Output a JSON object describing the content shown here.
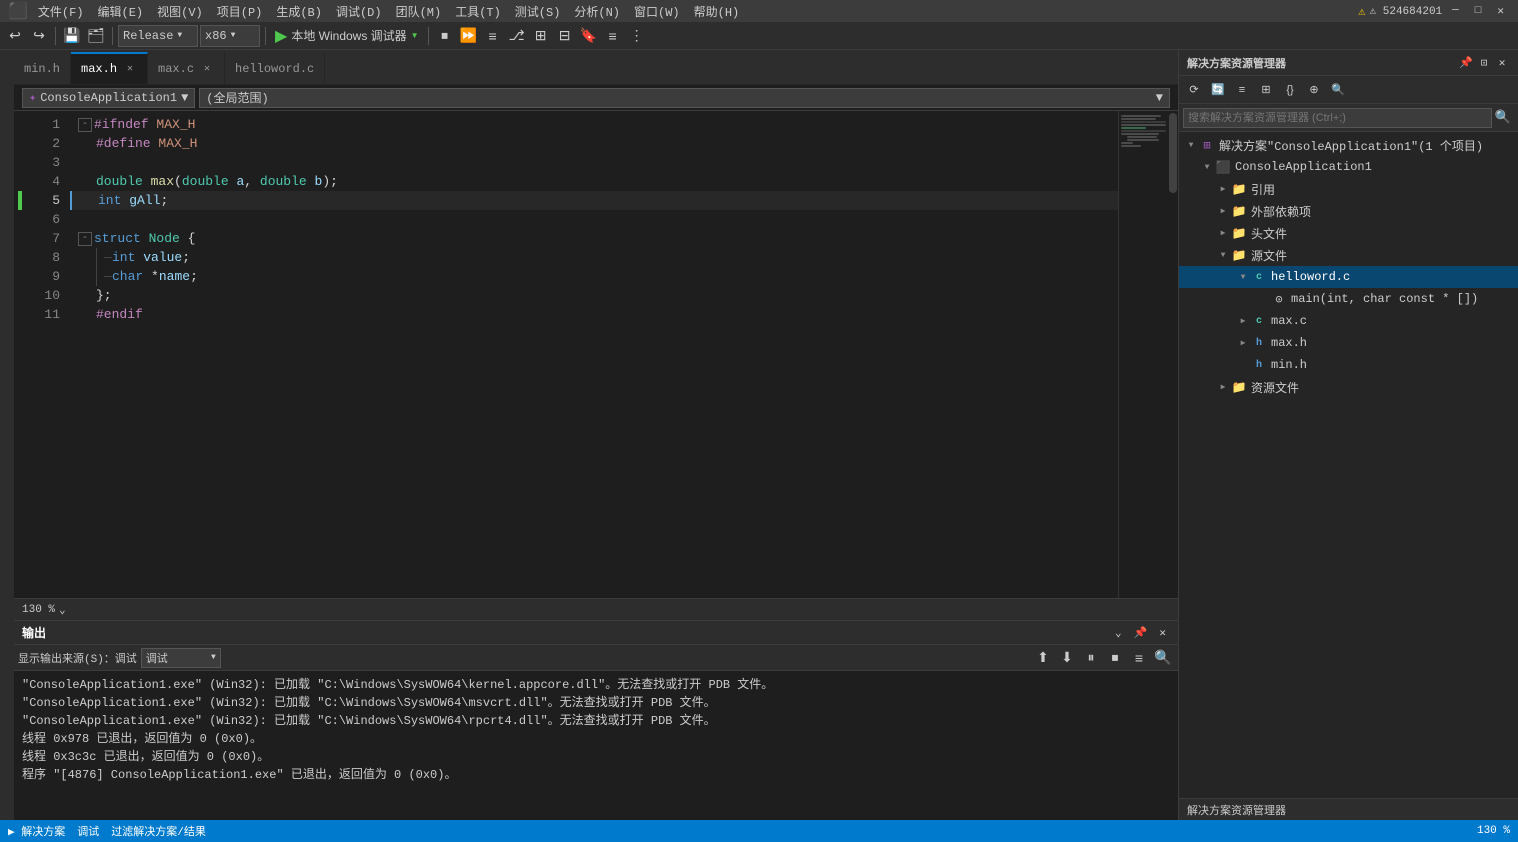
{
  "titlebar": {
    "left_icons": "≡",
    "right_text": "⚠ 524684201",
    "close_btn": "✕"
  },
  "menubar": {
    "items": [
      "文件(F)",
      "编辑(E)",
      "视图(V)",
      "项目(P)",
      "生成(B)",
      "调试(D)",
      "团队(M)",
      "工具(T)",
      "测试(S)",
      "分析(N)",
      "窗口(W)",
      "帮助(H)"
    ]
  },
  "toolbar": {
    "config_label": "Release",
    "arch_label": "x86",
    "play_label": "本地 Windows 调试器",
    "play_arrow": "▶"
  },
  "tabs": [
    {
      "label": "min.h",
      "active": false,
      "closable": false
    },
    {
      "label": "max.h",
      "active": true,
      "closable": true
    },
    {
      "label": "max.c",
      "active": false,
      "closable": true
    },
    {
      "label": "helloword.c",
      "active": false,
      "closable": false
    }
  ],
  "navbar": {
    "project": "ConsoleApplication1",
    "scope": "(全局范围)"
  },
  "code": {
    "filename": "max.h",
    "lines": [
      {
        "num": 1,
        "content": "#ifndef MAX_H",
        "type": "preprocessor"
      },
      {
        "num": 2,
        "content": "#define MAX_H",
        "type": "preprocessor"
      },
      {
        "num": 3,
        "content": "",
        "type": "empty"
      },
      {
        "num": 4,
        "content": "double max(double a, double b);",
        "type": "code"
      },
      {
        "num": 5,
        "content": "int gAll;",
        "type": "code",
        "highlighted": true
      },
      {
        "num": 6,
        "content": "",
        "type": "empty"
      },
      {
        "num": 7,
        "content": "struct Node {",
        "type": "code"
      },
      {
        "num": 8,
        "content": "    int value;",
        "type": "code"
      },
      {
        "num": 9,
        "content": "    char *name;",
        "type": "code"
      },
      {
        "num": 10,
        "content": "};",
        "type": "code"
      },
      {
        "num": 11,
        "content": "#endif",
        "type": "preprocessor"
      }
    ]
  },
  "solution_explorer": {
    "title": "解决方案资源管理器",
    "search_placeholder": "搜索解决方案资源管理器 (Ctrl+;)",
    "solution_label": "解决方案\"ConsoleApplication1\"(1 个项目)",
    "project_label": "ConsoleApplication1",
    "nodes": [
      {
        "label": "引用",
        "indent": 2,
        "expanded": false,
        "icon": "📁"
      },
      {
        "label": "外部依赖项",
        "indent": 2,
        "expanded": false,
        "icon": "📁"
      },
      {
        "label": "头文件",
        "indent": 2,
        "expanded": false,
        "icon": "📁"
      },
      {
        "label": "源文件",
        "indent": 2,
        "expanded": true,
        "icon": "📁"
      },
      {
        "label": "helloword.c",
        "indent": 3,
        "expanded": true,
        "icon": "C",
        "color": "#4ec9b0"
      },
      {
        "label": "main(int, char const * [])",
        "indent": 4,
        "icon": "⚙",
        "color": "#dcdcaa"
      },
      {
        "label": "max.c",
        "indent": 3,
        "icon": "C",
        "color": "#4ec9b0"
      },
      {
        "label": "max.h",
        "indent": 3,
        "icon": "H",
        "color": "#569cd6"
      },
      {
        "label": "min.h",
        "indent": 3,
        "icon": "H",
        "color": "#569cd6"
      },
      {
        "label": "资源文件",
        "indent": 2,
        "expanded": false,
        "icon": "📁"
      }
    ]
  },
  "output": {
    "title": "输出",
    "source_label": "显示输出来源(S)：调试",
    "lines": [
      "\"ConsoleApplication1.exe\" (Win32): 已加载 \"C:\\Windows\\SysWOW64\\kernel.appcore.dll\"。无法查找或打开 PDB 文件。",
      "\"ConsoleApplication1.exe\" (Win32): 已加载 \"C:\\Windows\\SysWOW64\\msvcrt.dll\"。无法查找或打开 PDB 文件。",
      "\"ConsoleApplication1.exe\" (Win32): 已加载 \"C:\\Windows\\SysWOW64\\rpcrt4.dll\"。无法查找或打开 PDB 文件。",
      "线程 0x978 已退出，返回值为 0 (0x0)。",
      "线程 0x3c3c 已退出，返回值为 0 (0x0)。",
      "程序 \"[4876] ConsoleApplication1.exe\" 已退出，返回值为 0 (0x0)。"
    ]
  },
  "statusbar": {
    "zoom": "130 %",
    "items_left": [
      "▶ 解决方案",
      "调试",
      "过滤解决方案/结果"
    ],
    "items_right": []
  }
}
